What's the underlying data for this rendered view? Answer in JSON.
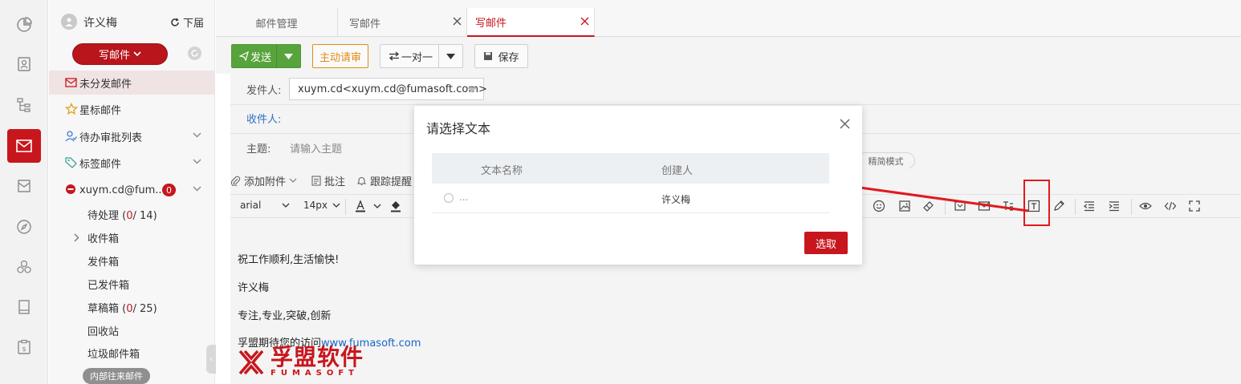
{
  "colors": {
    "brand": "#c8161d",
    "send_green": "#57a33c",
    "review_orange": "#e38c14",
    "link_blue": "#1a64c8",
    "annotation_red": "#e0191f"
  },
  "rail": {
    "icons": [
      "pie-chart-icon",
      "contacts-icon",
      "org-tree-icon",
      "mail-icon",
      "inbox-tray-icon",
      "compass-icon",
      "group-icon",
      "book-icon",
      "clipboard-dollar-icon"
    ]
  },
  "sidebar": {
    "user_name": "许义梅",
    "bottom_link": "下届",
    "compose_label": "写邮件",
    "nav": [
      {
        "label": "未分发邮件",
        "icon": "mail-x-icon"
      },
      {
        "label": "星标邮件",
        "icon": "star-icon"
      },
      {
        "label": "待办审批列表",
        "icon": "user-check-icon"
      },
      {
        "label": "标签邮件",
        "icon": "tag-icon"
      },
      {
        "label": "xuym.cd@fum...",
        "icon": "account-dot-icon",
        "badge": "0"
      }
    ],
    "folders": [
      {
        "label": "待处理",
        "count_prefix": "(",
        "count_unread": "0",
        "count_rest": "/ 14)"
      },
      {
        "label": "收件箱"
      },
      {
        "label": "发件箱"
      },
      {
        "label": "已发件箱"
      },
      {
        "label": "草稿箱",
        "count_prefix": "(",
        "count_unread": "0",
        "count_rest": "/ 25)"
      },
      {
        "label": "回收站"
      },
      {
        "label": "垃圾邮件箱"
      }
    ],
    "tag_pill": "内部往来邮件"
  },
  "tabs": [
    {
      "label": "邮件管理"
    },
    {
      "label": "写邮件"
    },
    {
      "label": "写邮件"
    }
  ],
  "toolbar": {
    "send_label": "发送",
    "review_label": "主动请审",
    "mode_label": "一对一",
    "save_label": "保存"
  },
  "form": {
    "sender_label": "发件人:",
    "sender_value": "xuym.cd<xuym.cd@fumasoft.com>",
    "recipient_label": "收件人:",
    "subject_label": "主题:",
    "subject_placeholder": "请输入主题",
    "mode_pill": "精简模式"
  },
  "attach_bar": {
    "attach": "添加附件",
    "annotate": "批注",
    "track": "跟踪提醒"
  },
  "editor_toolbar": {
    "font": "arial",
    "size": "14px"
  },
  "editor_body": {
    "line1": "祝工作顺利,生活愉快!",
    "line2": "许义梅",
    "line3": "专注,专业,突破,创新",
    "line4_text": "孚盟期待您的访问",
    "line4_link": "www.fumasoft.com",
    "logo_cn": "孚盟软件",
    "logo_en": "FUMASOFT"
  },
  "dialog": {
    "title": "请选择文本",
    "columns": [
      "文本名称",
      "创建人"
    ],
    "rows": [
      {
        "name": "...",
        "creator": "许义梅"
      }
    ],
    "select_label": "选取"
  }
}
